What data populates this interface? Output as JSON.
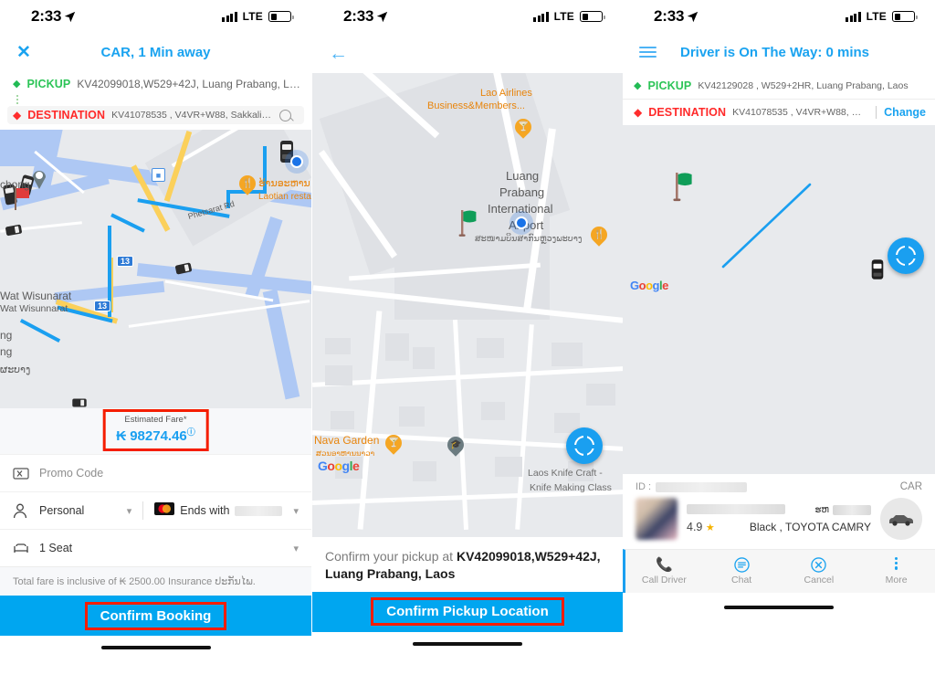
{
  "statusbar": {
    "time": "2:33",
    "network": "LTE",
    "location_icon": "location-arrow-icon"
  },
  "screen1": {
    "nav": {
      "close_icon": "close-icon",
      "title": "CAR, 1 Min away"
    },
    "pickup": {
      "label": "PICKUP",
      "value": "KV42099018,W529+42J, Luang Prabang, La..."
    },
    "destination": {
      "label": "DESTINATION",
      "value": "KV41078535 , V4VR+W88, Sakkaline R..."
    },
    "map": {
      "labels": [
        "chong",
        "Wat Wisunarat",
        "Wat Wisunnarat",
        "ng",
        "ng",
        "ຜະບາງ",
        "ຮ້ານອະຫານ",
        "Laotian resta",
        "Phetsarat Rd",
        "13",
        "13"
      ],
      "highway_shield": "13",
      "attribution": "Google"
    },
    "fare": {
      "label": "Estimated Fare*",
      "currency": "₭",
      "amount": "98274.46",
      "info": "ⓘ"
    },
    "options": [
      {
        "icon": "promo-ticket-icon",
        "label": "Promo Code",
        "muted": true
      },
      {
        "icon": "person-icon",
        "label": "Personal",
        "muted": false
      },
      {
        "icon": "seat-icon",
        "label": "1 Seat",
        "muted": false
      }
    ],
    "payment": {
      "icon": "mastercard-icon",
      "label": "Ends with",
      "masked": true
    },
    "note": "Total fare is inclusive of ₭ 2500.00 Insurance ປະກັນໄພ.",
    "cta": "Confirm Booking"
  },
  "screen2": {
    "nav": {
      "back_icon": "back-arrow-icon"
    },
    "map": {
      "labels": [
        "Lao Airlines",
        "Business&Members...",
        "Luang",
        "Prabang",
        "International",
        "Airport",
        "ສະໜາມບິນສາກົນຫຼວງພະບາງ",
        "Nava Garden",
        "ສວນອາຫານນາວາ",
        "Laos Knife Craft -",
        "Knife Making Class"
      ],
      "attribution": "Google"
    },
    "confirm": {
      "lead": "Confirm your pickup at ",
      "address": "KV42099018,W529+42J, Luang Prabang, Laos"
    },
    "cta": "Confirm Pickup Location"
  },
  "screen3": {
    "nav": {
      "menu_icon": "hamburger-icon",
      "title": "Driver is On The Way: 0 mins"
    },
    "pickup": {
      "label": "PICKUP",
      "value": "KV42129028 , W529+2HR, Luang Prabang, Laos"
    },
    "destination": {
      "label": "DESTINATION",
      "value": "KV41078535 , V4VR+W88, S...",
      "change": "Change"
    },
    "map": {
      "attribution": "Google"
    },
    "driver": {
      "id_label": "ID :",
      "id_value_masked": true,
      "vehicle_type": "CAR",
      "name_masked": true,
      "rating": "4.9",
      "plate_prefix": "ຮຫ",
      "plate_masked": true,
      "car_description": "Black , TOYOTA CAMRY"
    },
    "actions": [
      {
        "icon": "phone-icon",
        "label": "Call Driver"
      },
      {
        "icon": "chat-icon",
        "label": "Chat"
      },
      {
        "icon": "cancel-circle-icon",
        "label": "Cancel"
      },
      {
        "icon": "more-dots-icon",
        "label": "More"
      }
    ]
  },
  "colors": {
    "accent": "#1aa3f0",
    "cta": "#00a6f0",
    "pickup": "#2cc457",
    "destination": "#ff2a2a",
    "highlight": "#f51d00"
  }
}
